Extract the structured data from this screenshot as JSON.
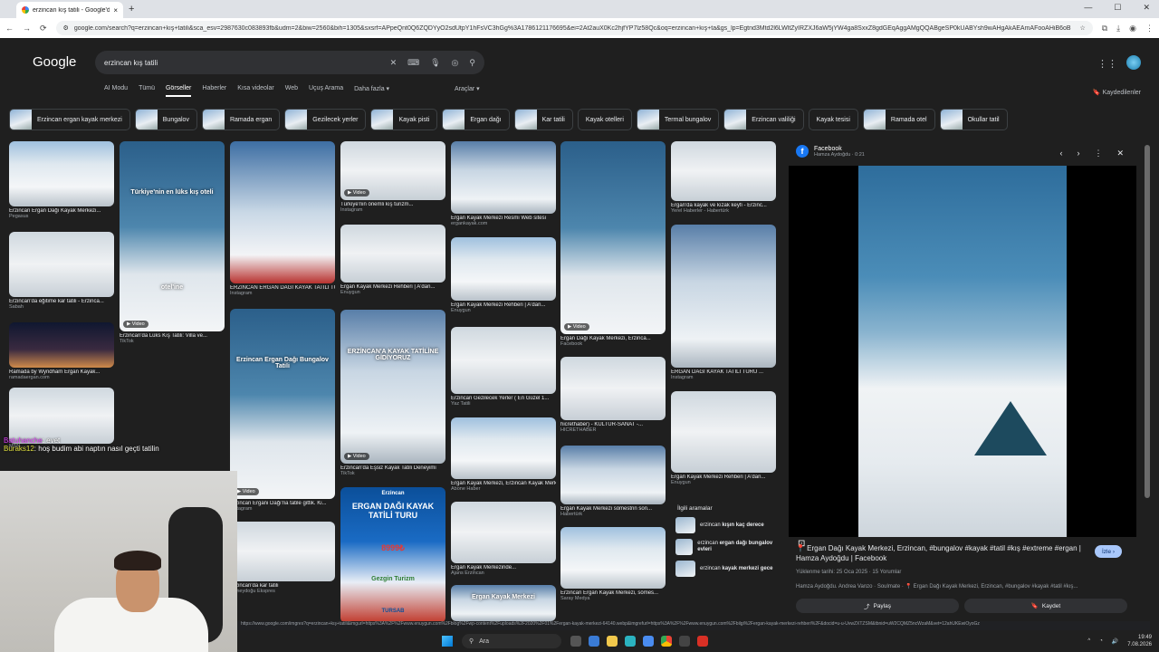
{
  "browser": {
    "tab_title": "erzincan kış tatili - Google'da A",
    "tab_close": "×",
    "new_tab": "+",
    "url": "google.com/search?q=erzincan+kış+tatili&sca_esv=2987630c083893fb&udm=2&biw=2560&bih=1305&sxsrf=APpeQnt0Q6ZQDYyO2sdUtpY1hFsVC3hGg%3A1786121176695&ei=2At2auX0Kc2hjfYP7lz58Qc&oq=erzincan+kış+ta&gs_lp=Egtnd3Mtd2l6LWltZyIRZXJ6aW5jYW4ga8SxxZ8gdGEqAggAMgQQABgeSP0kUABYsh9wAHgAkAEAmAFooAHiB6oB",
    "nav_back": "←",
    "nav_forward": "→",
    "nav_reload": "⟳",
    "win_min": "—",
    "win_max": "☐",
    "win_close": "✕"
  },
  "google": {
    "logo": "Google",
    "query": "erzincan kış tatili",
    "clear_icon": "✕",
    "nav": [
      "AI Modu",
      "Tümü",
      "Görseller",
      "Haberler",
      "Kısa videolar",
      "Web",
      "Uçuş Arama",
      "Daha fazla"
    ],
    "more_arrow": "▾",
    "tools": "Araçlar",
    "saved": "Kaydedilenler",
    "chips": [
      {
        "label": "Erzincan ergan kayak merkezi",
        "thumb": true
      },
      {
        "label": "Bungalov",
        "thumb": true
      },
      {
        "label": "Ramada ergan",
        "thumb": true
      },
      {
        "label": "Gezilecek yerler",
        "thumb": true
      },
      {
        "label": "Kayak pisti",
        "thumb": true
      },
      {
        "label": "Ergan dağı",
        "thumb": true
      },
      {
        "label": "Kar tatili",
        "thumb": true
      },
      {
        "label": "Kayak otelleri",
        "thumb": false
      },
      {
        "label": "Termal bungalov",
        "thumb": true
      },
      {
        "label": "Erzincan valiliği",
        "thumb": true
      },
      {
        "label": "Kayak tesisi",
        "thumb": false
      },
      {
        "label": "Ramada otel",
        "thumb": true
      },
      {
        "label": "Okullar tatil",
        "thumb": true
      }
    ]
  },
  "results": [
    {
      "cap": "Erzincan Ergan Dağı Kayak Merkezi...",
      "src": "Pegasus"
    },
    {
      "cap": "Erzincan'da eğitime kar tatili - Erzinca...",
      "src": "Sabah"
    },
    {
      "cap": "Ramada by Wyndham Ergan Kayak...",
      "src": "ramadaergan.com"
    },
    {
      "cap": "",
      "src": "MSN"
    },
    {
      "cap": "Erzincan'da Lüks Kış Tatili: Villa ve...",
      "src": "TikTok",
      "overlay": "Türkiye'nin en lüks kış oteli",
      "overlay2": "otel'ine",
      "video": "Video"
    },
    {
      "cap": "ERZİNCAN ERGAN DAĞI KAYAK TATİLİ TURU ...",
      "src": "Instagram"
    },
    {
      "cap": "ERZİNCAN ERGAN DAĞI KAYAK TATİLİ TURU ...",
      "src": "Instagram"
    },
    {
      "cap": "Erzincan Ergani Dağı'na tatile gittik. Ki...",
      "src": "Instagram",
      "overlay": "Erzincan Ergan Dağı Bungalov Tatili",
      "video": "Video"
    },
    {
      "cap": "Erzincan'da kar tatili",
      "src": "Güneydoğu Ekspres"
    },
    {
      "cap": "Türkiye'nin önemli kış turizm...",
      "src": "Instagram",
      "video": "Video"
    },
    {
      "cap": "Ergan Kayak Merkezi Rehberi | A'dan...",
      "src": "Enuygun"
    },
    {
      "cap": "Erzincan'da Eşsiz Kayak Tatili Deneyimi",
      "src": "TikTok",
      "overlay": "ERZİNCAN'A KAYAK TATİLİNE GİDİYORUZ",
      "video": "Video"
    },
    {
      "cap": "",
      "src": "",
      "poster1": "Erzincan",
      "poster2": "ERGAN DAĞI KAYAK TATİLİ TURU",
      "poster3": "8999₺",
      "poster4": "Gezgin Turizm",
      "poster5": "TURSAB"
    },
    {
      "cap": "Ergan Kayak Merkezi Resmi Web sitesi",
      "src": "ergankayak.com"
    },
    {
      "cap": "Ergan Kayak Merkezi Rehberi | A'dan...",
      "src": "Enuygun"
    },
    {
      "cap": "Erzincan Gezilecek Yerler ( En Güzel 1...",
      "src": "Yaz Tatili"
    },
    {
      "cap": "Ergan Kayak Merkezi, Erzincan Kayak Merkezi...",
      "src": "Abone Haber"
    },
    {
      "cap": "Ergan Kayak Merkezinde...",
      "src": "Ajans Erzincan"
    },
    {
      "cap": "",
      "src": "",
      "overlay": "Ergan Kayak Merkezi"
    },
    {
      "cap": "Ergan Dağı Kayak Merkezi, Erzinca...",
      "src": "Facebook",
      "video": "Video"
    },
    {
      "cap": "hicrethaber) - KÜLTÜR-SANAT -...",
      "src": "HİCRETHABER"
    },
    {
      "cap": "Ergan Kayak Merkezi sömestrin son...",
      "src": "Habertürk"
    },
    {
      "cap": "Erzincan Ergan Kayak Merkezi, sömes...",
      "src": "Saray Medya"
    },
    {
      "cap": "Ergan'da kayak ve kızak keyfi - Erzinc...",
      "src": "Yerel Haberler - Habertürk"
    },
    {
      "cap": "ERGAN DAĞI KAYAK TATİLİ TURU ...",
      "src": "Instagram"
    },
    {
      "cap": "Ergan Kayak Merkezi Rehberi | A'dan...",
      "src": "Enuygun"
    }
  ],
  "related": {
    "title": "İlgili aramalar",
    "items": [
      {
        "pre": "erzincan ",
        "bold": "kışın kaç derece"
      },
      {
        "pre": "erzincan ",
        "bold": "ergan dağı bungalov evleri"
      },
      {
        "pre": "erzincan ",
        "bold": "kayak merkezi gece"
      }
    ]
  },
  "panel": {
    "site": "Facebook",
    "author_time": "Hamza Aydoğdu · 0:21",
    "title": "📍 Ergan Dağı Kayak Merkezi, Erzincan, #bungalov #kayak #tatil #kış #extreme #ergan | Hamza Aydoğdu | Facebook",
    "watch": "İzle",
    "uploaded": "Yüklenme tarihi: 25 Oca 2025 · 15 Yorumlar",
    "desc": "Hamza Aydoğdu. Andrea Vanzo · Soulmate · 📍 Ergan Dağı Kayak Merkezi, Erzincan, #bungalov #kayak #tatil #kış...",
    "share": "Paylaş",
    "save": "Kaydet"
  },
  "chat": [
    {
      "user": "Batuhanche",
      "msg": ": evet"
    },
    {
      "user": "Buraks12",
      "msg": ": hoş budim abi naptın nasıl geçti tatilin"
    }
  ],
  "status_url": "https://www.google.com/imgres?q=erzincan+kış+tatili&imgurl=https%3A%2F%2Fwww.enuygun.com%2Fblog%2Fwp-content%2Fuploads%2F2020%2F01%2Fergan-kayak-merkezi-64140.webp&imgrefurl=https%3A%2F%2Fwww.enuygun.com%2Fbilgi%2Fergan-kayak-merkezi-rehberi%2F&docid=u-u-UvwZXTZSM&tbnid=uW2CQMZ5ncWzaM&vet=12ahUKEwiOyoGz",
  "taskbar": {
    "search": "Ara",
    "time": "19:49",
    "date": "7.08.2026"
  }
}
